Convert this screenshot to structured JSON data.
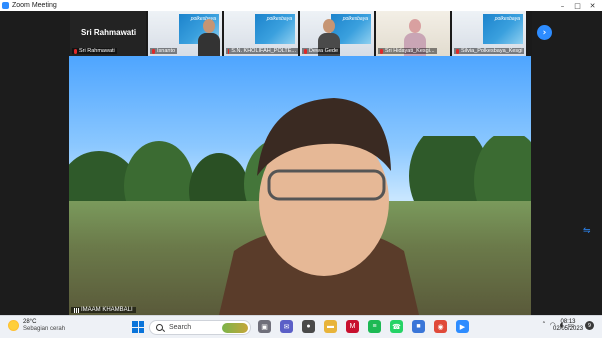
{
  "window": {
    "title": "Zoom Meeting",
    "controls": [
      "–",
      "□",
      "✕"
    ]
  },
  "gallery": {
    "active_speaker": {
      "big_name": "Sri Rahmawati",
      "label": "Sri Rahmawati"
    },
    "participants": [
      {
        "label": "Isnanto",
        "poster_text": "polkesbaya"
      },
      {
        "label": "S.N. KHOLIFAH_POLTE...",
        "poster_text": "polkesbaya"
      },
      {
        "label": "Dewa Gede",
        "poster_text": "polkesbaya"
      },
      {
        "label": "Sri Hidayati_Kesgi...",
        "poster_text": "polkesbaya"
      },
      {
        "label": "Silvia_Polkesbaya_Kesgi",
        "poster_text": "polkesbaya"
      }
    ],
    "next_icon": "chevron-right-icon"
  },
  "main_video": {
    "speaker_name": "IMAAM KHAMBALI"
  },
  "taskbar": {
    "weather": {
      "temp": "28°C",
      "condition": "Sebagian cerah"
    },
    "search_label": "Search",
    "apps": [
      {
        "name": "task-view",
        "color": "#6f6f7a",
        "glyph": "▣"
      },
      {
        "name": "chat",
        "color": "#5b5fc7",
        "glyph": "✉"
      },
      {
        "name": "camera",
        "color": "#4a4a4a",
        "glyph": "●"
      },
      {
        "name": "file-explorer",
        "color": "#e8b43a",
        "glyph": "▬"
      },
      {
        "name": "mcafee",
        "color": "#c8102e",
        "glyph": "M"
      },
      {
        "name": "spotify",
        "color": "#1db954",
        "glyph": "≡"
      },
      {
        "name": "whatsapp",
        "color": "#25d366",
        "glyph": "☎"
      },
      {
        "name": "store",
        "color": "#3a76d8",
        "glyph": "■"
      },
      {
        "name": "chrome",
        "color": "#e04a3a",
        "glyph": "◉"
      },
      {
        "name": "zoom",
        "color": "#2d8cff",
        "glyph": "▶"
      }
    ],
    "clock": {
      "time": "08:13",
      "date": "02/05/2023"
    },
    "notifications": "9"
  }
}
